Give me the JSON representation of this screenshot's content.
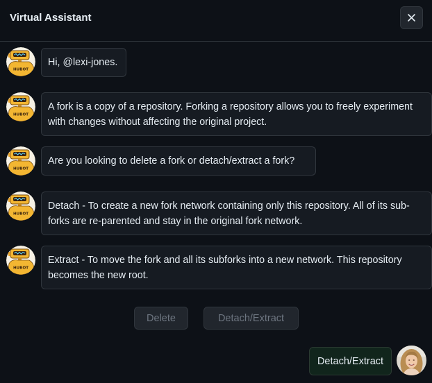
{
  "window": {
    "title": "Virtual Assistant",
    "close_icon": "close-icon"
  },
  "bot": {
    "avatar_icon": "hubot-icon",
    "avatar_label": "HUBOT"
  },
  "messages": [
    {
      "from": "bot",
      "text": "Hi, @lexi-jones."
    },
    {
      "from": "bot",
      "text": "A fork is a copy of a repository. Forking a repository allows you to freely experiment with changes without affecting the original project."
    },
    {
      "from": "bot",
      "text": "Are you looking to delete a fork or detach/extract a fork?"
    },
    {
      "from": "bot",
      "text": "Detach - To create a new fork network containing only this repository. All of its sub-forks are re-parented and stay in the original fork network."
    },
    {
      "from": "bot",
      "text": "Extract - To move the fork and all its subforks into a new network. This repository becomes the new root."
    }
  ],
  "actions": {
    "delete_label": "Delete",
    "detach_extract_label": "Detach/Extract",
    "state": "disabled"
  },
  "user_reply": {
    "text": "Detach/Extract",
    "avatar_icon": "user-avatar-photo"
  },
  "colors": {
    "background": "#0d1117",
    "bubble": "#161b22",
    "border": "#30363d",
    "text": "#e6edf3",
    "disabled_text": "#6e7681",
    "user_bubble": "#11251c",
    "bot_yellow": "#f3b632"
  }
}
